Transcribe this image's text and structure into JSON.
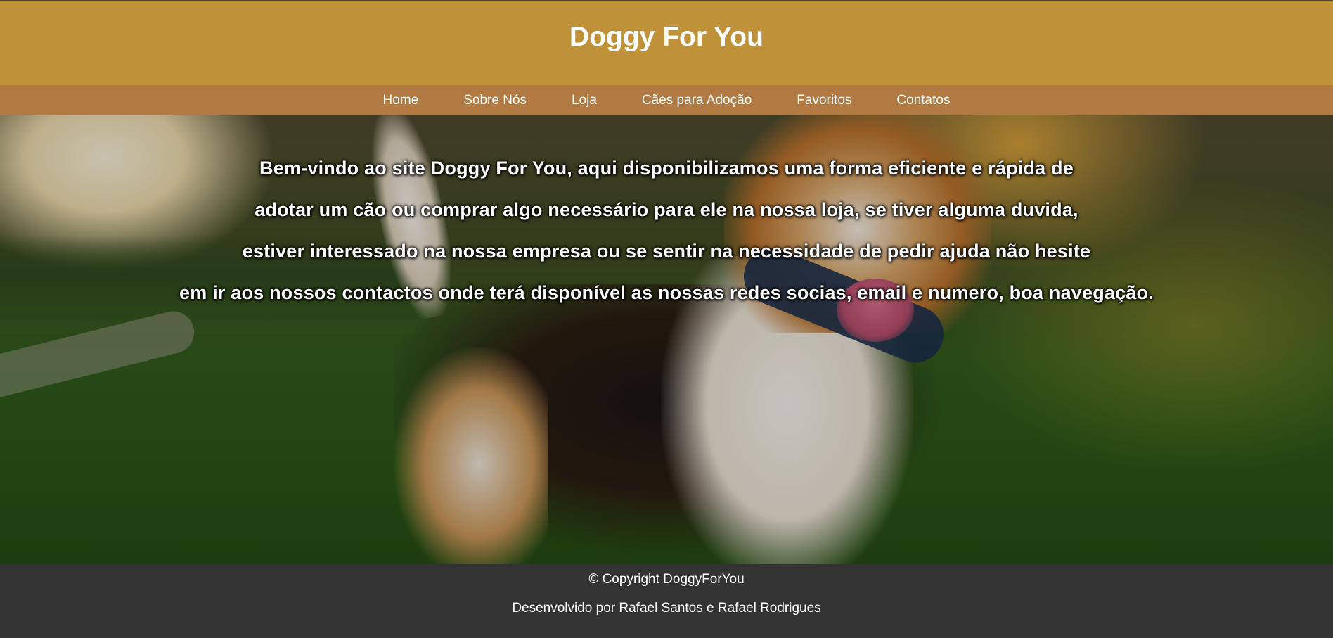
{
  "header": {
    "title": "Doggy For You"
  },
  "nav": {
    "items": [
      {
        "label": "Home"
      },
      {
        "label": "Sobre Nós"
      },
      {
        "label": "Loja"
      },
      {
        "label": "Cães para Adoção"
      },
      {
        "label": "Favoritos"
      },
      {
        "label": "Contatos"
      }
    ]
  },
  "hero": {
    "lines": [
      "Bem-vindo ao site Doggy For You, aqui disponibilizamos uma forma eficiente e rápida de",
      "adotar um cão ou comprar algo necessário para ele na nossa loja, se tiver alguma duvida,",
      "estiver interessado na nossa empresa ou se sentir na necessidade de pedir ajuda não hesite",
      "em ir aos nossos contactos onde terá disponível as nossas redes socias, email e numero, boa navegação."
    ]
  },
  "footer": {
    "copyright": "© Copyright DoggyForYou",
    "developers": "Desenvolvido por Rafael Santos e Rafael Rodrigues"
  }
}
